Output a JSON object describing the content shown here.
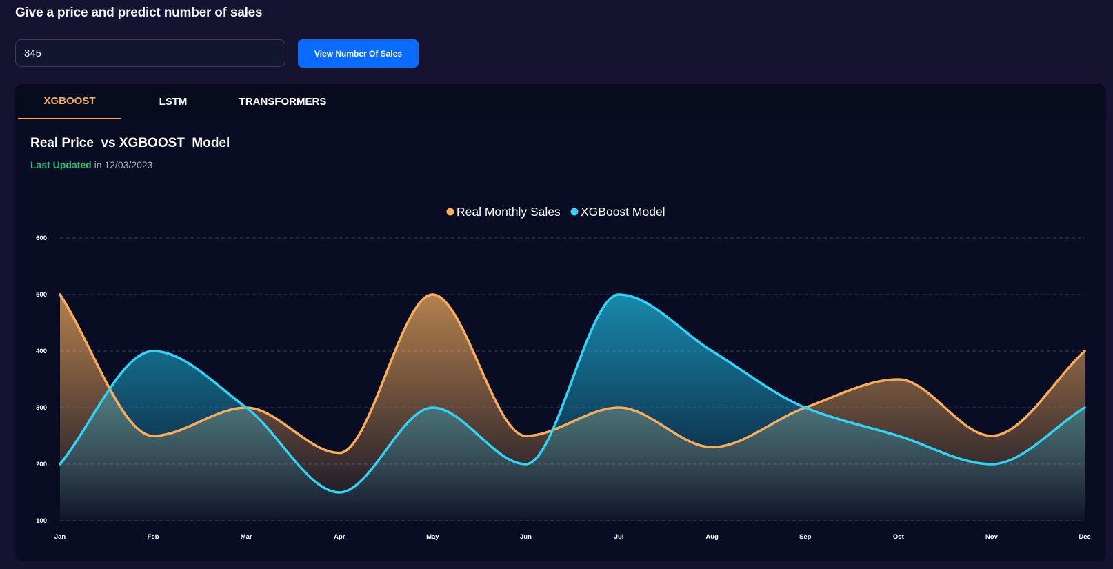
{
  "header": {
    "title": "Give a price and predict number of sales",
    "price_value": "345",
    "button_label": "View Number Of Sales"
  },
  "tabs": [
    {
      "label": "XGBOOST",
      "active": true
    },
    {
      "label": "LSTM",
      "active": false
    },
    {
      "label": "TRANSFORMERS",
      "active": false
    }
  ],
  "panel": {
    "title": "Real Price  vs XGBOOST  Model",
    "updated_label": "Last Updated",
    "updated_rest": " in 12/03/2023"
  },
  "colors": {
    "real": "#f7ad5c",
    "model": "#31d4f5",
    "accent": "#0a6cff",
    "updated": "#1fbf75"
  },
  "chart_data": {
    "type": "area",
    "categories": [
      "Jan",
      "Feb",
      "Mar",
      "Apr",
      "May",
      "Jun",
      "Jul",
      "Aug",
      "Sep",
      "Oct",
      "Nov",
      "Dec"
    ],
    "series": [
      {
        "name": "Real Monthly Sales",
        "values": [
          500,
          250,
          300,
          220,
          500,
          250,
          300,
          230,
          300,
          350,
          250,
          400
        ]
      },
      {
        "name": "XGBoost Model",
        "values": [
          200,
          400,
          300,
          150,
          300,
          200,
          500,
          400,
          300,
          250,
          200,
          300
        ]
      }
    ],
    "yticks": [
      600,
      500,
      400,
      300,
      200,
      100
    ],
    "ylim": [
      100,
      600
    ],
    "grid": true,
    "legend": "top-center"
  }
}
